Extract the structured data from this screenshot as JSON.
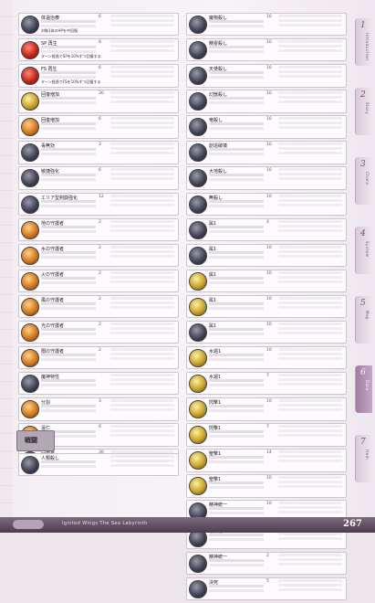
{
  "left_entries": [
    {
      "name": "体温治療",
      "cost": "6",
      "desc": "対象1体のHPを中回復",
      "icon": "dark"
    },
    {
      "name": "SP 再生",
      "cost": "8",
      "desc": "ターン経過でSPを10%ずつ回復する",
      "icon": "red"
    },
    {
      "name": "FS 再生",
      "cost": "6",
      "desc": "ターン経過でFSを10%ずつ回復する",
      "icon": "red"
    },
    {
      "name": "回復増加",
      "cost": "30",
      "desc": "",
      "icon": "gold"
    },
    {
      "name": "回復増加",
      "cost": "6",
      "desc": "",
      "icon": "orange"
    },
    {
      "name": "毒無効",
      "cost": "3",
      "desc": "",
      "icon": "dark"
    },
    {
      "name": "敏捷強化",
      "cost": "6",
      "desc": "",
      "icon": "dark"
    },
    {
      "name": "エリア型剣闘強化",
      "cost": "12",
      "desc": "",
      "icon": "dark"
    },
    {
      "name": "地の守護者",
      "cost": "2",
      "desc": "",
      "icon": "orange"
    },
    {
      "name": "水の守護者",
      "cost": "2",
      "desc": "",
      "icon": "orange"
    },
    {
      "name": "火の守護者",
      "cost": "2",
      "desc": "",
      "icon": "orange"
    },
    {
      "name": "風の守護者",
      "cost": "2",
      "desc": "",
      "icon": "orange"
    },
    {
      "name": "光の守護者",
      "cost": "2",
      "desc": "",
      "icon": "orange"
    },
    {
      "name": "闇の守護者",
      "cost": "2",
      "desc": "",
      "icon": "orange"
    },
    {
      "name": "魔神特性",
      "cost": "",
      "desc": "",
      "icon": "dark"
    },
    {
      "name": "分割",
      "cost": "3",
      "desc": "",
      "icon": "orange"
    },
    {
      "name": "遠仁",
      "cost": "6",
      "desc": "",
      "icon": "orange"
    },
    {
      "name": "回復量",
      "cost": "30",
      "desc": "",
      "icon": "dark"
    }
  ],
  "senjutsu": {
    "heading": "戦闘",
    "desc": ""
  },
  "left_after": [
    {
      "name": "人類殺し",
      "cost": "",
      "desc": "",
      "icon": "dark"
    }
  ],
  "right_entries": [
    {
      "name": "魔物殺し",
      "cost": "10",
      "desc": "",
      "icon": "dark"
    },
    {
      "name": "精霊殺し",
      "cost": "10",
      "desc": "",
      "icon": "dark"
    },
    {
      "name": "天使殺し",
      "cost": "10",
      "desc": "",
      "icon": "dark"
    },
    {
      "name": "幻獣殺し",
      "cost": "10",
      "desc": "",
      "icon": "dark"
    },
    {
      "name": "竜殺し",
      "cost": "10",
      "desc": "",
      "icon": "dark"
    },
    {
      "name": "創造破壊",
      "cost": "10",
      "desc": "",
      "icon": "dark"
    },
    {
      "name": "大地殺し",
      "cost": "10",
      "desc": "",
      "icon": "dark"
    },
    {
      "name": "無殺し",
      "cost": "10",
      "desc": "",
      "icon": "dark"
    },
    {
      "name": "属1",
      "cost": "4",
      "desc": "",
      "icon": "dark"
    },
    {
      "name": "属1",
      "cost": "10",
      "desc": "",
      "icon": "dark"
    },
    {
      "name": "属1",
      "cost": "10",
      "desc": "",
      "icon": "gold"
    },
    {
      "name": "属1",
      "cost": "10",
      "desc": "",
      "icon": "gold"
    },
    {
      "name": "属1",
      "cost": "10",
      "desc": "",
      "icon": "dark"
    },
    {
      "name": "水遁1",
      "cost": "10",
      "desc": "",
      "icon": "gold"
    },
    {
      "name": "水遁1",
      "cost": "7",
      "desc": "",
      "icon": "gold"
    },
    {
      "name": "閃撃1",
      "cost": "10",
      "desc": "",
      "icon": "gold"
    },
    {
      "name": "閃撃1",
      "cost": "7",
      "desc": "",
      "icon": "gold"
    },
    {
      "name": "聖撃1",
      "cost": "14",
      "desc": "",
      "icon": "gold"
    },
    {
      "name": "聖撃1",
      "cost": "10",
      "desc": "",
      "icon": "gold"
    },
    {
      "name": "精神統一",
      "cost": "10",
      "desc": "",
      "icon": "dark"
    },
    {
      "name": "精神統一",
      "cost": "14",
      "desc": "",
      "icon": "dark"
    },
    {
      "name": "精神統一",
      "cost": "2",
      "desc": "",
      "icon": "dark"
    },
    {
      "name": "決死",
      "cost": "5",
      "desc": "",
      "icon": "dark"
    }
  ],
  "sidebar": [
    {
      "num": "1",
      "label": "Introduction",
      "active": false
    },
    {
      "num": "2",
      "label": "Story",
      "active": false
    },
    {
      "num": "3",
      "label": "Chara",
      "active": false
    },
    {
      "num": "4",
      "label": "System",
      "active": false
    },
    {
      "num": "5",
      "label": "Map",
      "active": false
    },
    {
      "num": "6",
      "label": "Data",
      "active": true
    },
    {
      "num": "7",
      "label": "Item",
      "active": false
    }
  ],
  "footer": {
    "text": "Ignited Wings  The Sea Labyrinth",
    "page": "267"
  }
}
